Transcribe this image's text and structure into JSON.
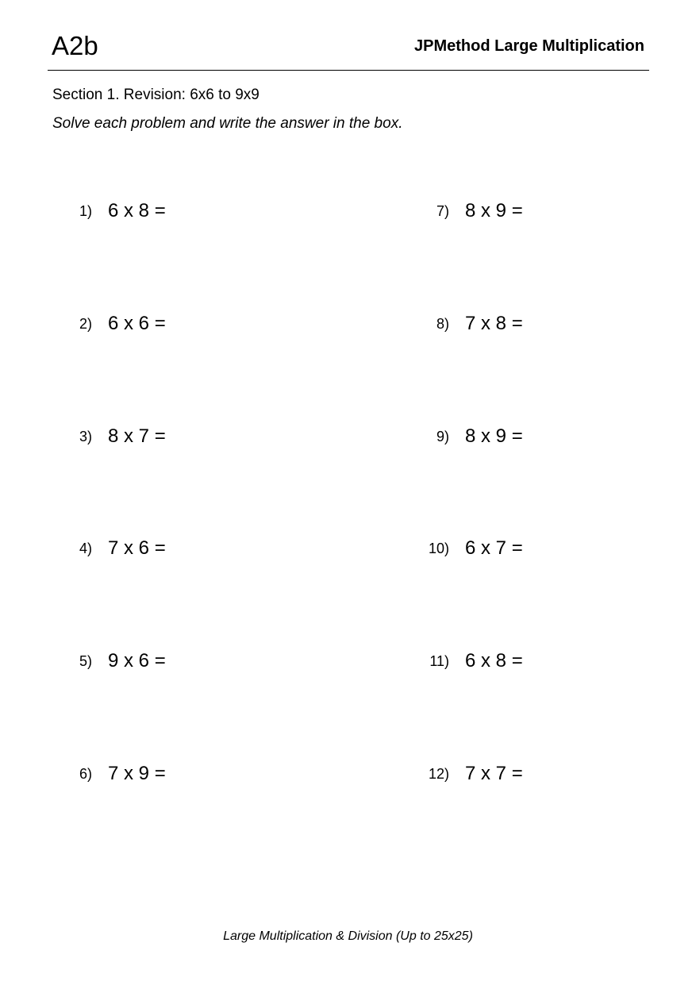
{
  "header": {
    "code": "A2b",
    "title": "JPMethod Large Multiplication"
  },
  "section": "Section 1. Revision: 6x6 to 9x9",
  "instructions": "Solve each problem and write the answer in the box.",
  "problems": [
    {
      "number": "1)",
      "expression": "6 x 8 ="
    },
    {
      "number": "2)",
      "expression": "6 x 6 ="
    },
    {
      "number": "3)",
      "expression": "8 x 7 ="
    },
    {
      "number": "4)",
      "expression": "7 x 6 ="
    },
    {
      "number": "5)",
      "expression": "9 x 6 ="
    },
    {
      "number": "6)",
      "expression": "7 x 9 ="
    },
    {
      "number": "7)",
      "expression": "8 x 9 ="
    },
    {
      "number": "8)",
      "expression": "7 x 8 ="
    },
    {
      "number": "9)",
      "expression": "8 x 9 ="
    },
    {
      "number": "10)",
      "expression": "6 x 7 ="
    },
    {
      "number": "11)",
      "expression": "6 x 8 ="
    },
    {
      "number": "12)",
      "expression": "7 x 7 ="
    }
  ],
  "footer": "Large Multiplication & Division (Up to 25x25)"
}
